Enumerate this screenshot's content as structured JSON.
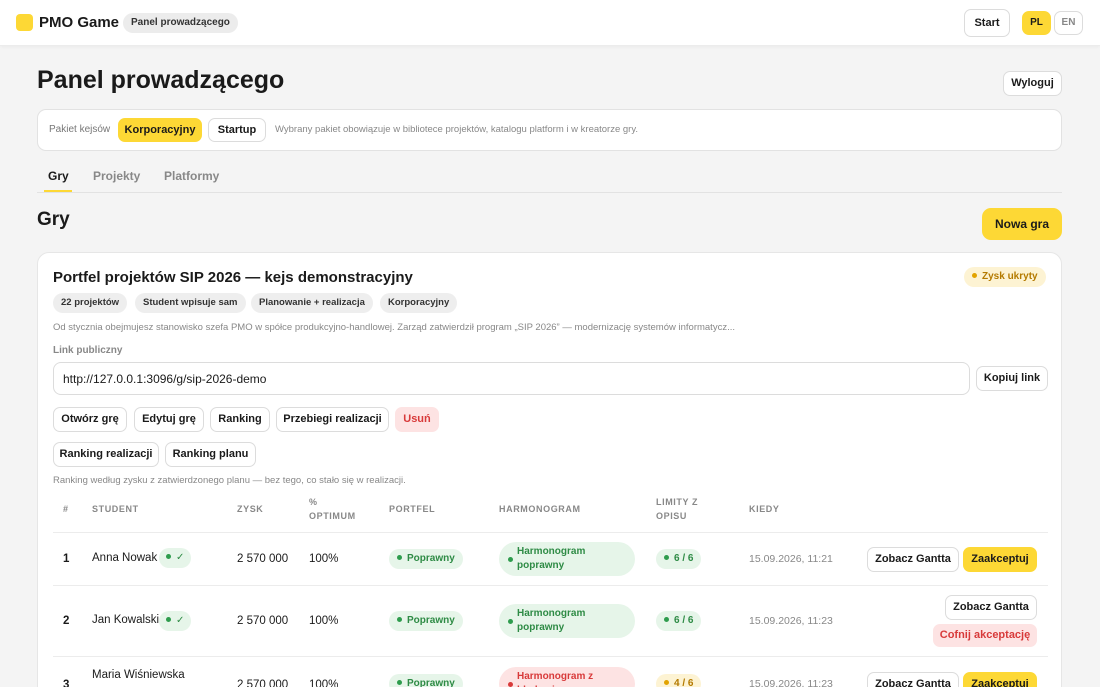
{
  "header": {
    "app_title": "PMO Game",
    "badge": "Panel prowadzącego",
    "start_label": "Start",
    "lang_active": "PL",
    "lang_other": "EN"
  },
  "page": {
    "title": "Panel prowadzącego",
    "logout_label": "Wyloguj"
  },
  "package": {
    "label": "Pakiet kejsów",
    "options": [
      "Korporacyjny",
      "Startup"
    ],
    "selected": "Korporacyjny",
    "note": "Wybrany pakiet obowiązuje w bibliotece projektów, katalogu platform i w kreatorze gry."
  },
  "tabs": [
    {
      "label": "Gry",
      "active": true
    },
    {
      "label": "Projekty",
      "active": false
    },
    {
      "label": "Platformy",
      "active": false
    }
  ],
  "section": {
    "title": "Gry",
    "new_game_label": "Nowa gra"
  },
  "game": {
    "title": "Portfel projektów SIP 2026 — kejs demonstracyjny",
    "status": "Zysk ukryty",
    "tags": [
      "22 projektów",
      "Student wpisuje sam",
      "Planowanie + realizacja",
      "Korporacyjny"
    ],
    "description": "Od stycznia obejmujesz stanowisko szefa PMO w spółce produkcyjno-handlowej. Zarząd zatwierdził program „SIP 2026” — modernizację systemów informatycz...",
    "link_label": "Link publiczny",
    "link_value": "http://127.0.0.1:3096/g/sip-2026-demo",
    "copy_label": "Kopiuj link",
    "actions": {
      "open": "Otwórz grę",
      "edit": "Edytuj grę",
      "ranking": "Ranking",
      "runs": "Przebiegi realizacji",
      "delete": "Usuń",
      "ranking_realization": "Ranking realizacji",
      "ranking_plan": "Ranking planu"
    },
    "ranking_note": "Ranking według zysku z zatwierdzonego planu — bez tego, co stało się w realizacji.",
    "table": {
      "headers": {
        "rank": "#",
        "student": "STUDENT",
        "profit": "ZYSK",
        "optimum_1": "%",
        "optimum_2": "OPTIMUM",
        "portfolio": "PORTFEL",
        "schedule": "HARMONOGRAM",
        "limits_1": "LIMITY Z",
        "limits_2": "OPISU",
        "when": "KIEDY"
      },
      "rows": [
        {
          "rank": "1",
          "student": "Anna Nowak",
          "check": "✓",
          "profit": "2 570 000",
          "optimum": "100%",
          "portfolio": "Poprawny",
          "schedule": "Harmonogram poprawny",
          "limits": "6 / 6",
          "when": "15.09.2026, 11:21",
          "gantt_label": "Zobacz Gantta",
          "action_label": "Zaakceptuj"
        },
        {
          "rank": "2",
          "student": "Jan Kowalski",
          "check": "✓",
          "profit": "2 570 000",
          "optimum": "100%",
          "portfolio": "Poprawny",
          "schedule": "Harmonogram poprawny",
          "limits": "6 / 6",
          "when": "15.09.2026, 11:23",
          "gantt_label": "Zobacz Gantta",
          "action_label": "Cofnij akceptację"
        },
        {
          "rank": "3",
          "student": "Maria Wiśniewska",
          "profit": "2 570 000",
          "optimum": "100%",
          "portfolio": "Poprawny",
          "schedule": "Harmonogram z błędami",
          "limits": "4 / 6",
          "when": "15.09.2026, 11:23",
          "gantt_label": "Zobacz Gantta",
          "action_label": "Zaakceptuj"
        }
      ]
    }
  },
  "colors": {
    "accent": "#fdd835",
    "success": "#2e8b45",
    "danger": "#d83a3a",
    "warning": "#b47a00"
  }
}
